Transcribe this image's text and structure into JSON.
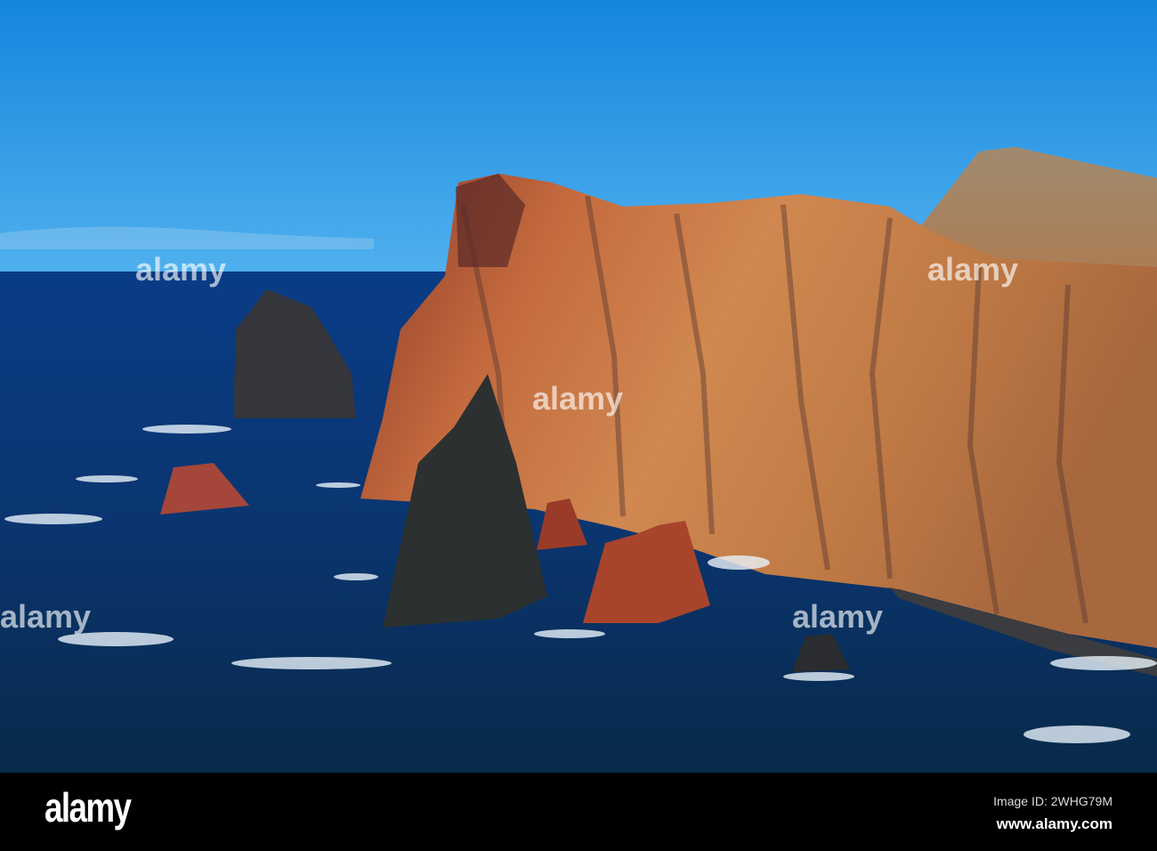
{
  "photo": {
    "subject": "Volcanic sea cliffs and rock stacks",
    "colors": {
      "sky_top": "#1585dd",
      "sky_horizon": "#4fb0ee",
      "ocean": "#0a3c86",
      "ocean_deep": "#082a55",
      "cliff": "#c0703e",
      "rock_dark": "#2d2f33",
      "rock_red": "#a8442c"
    }
  },
  "watermark": {
    "text": "alamy"
  },
  "footer": {
    "logo": "alamy",
    "image_id": "Image ID: 2WHG79M",
    "website": "www.alamy.com"
  }
}
